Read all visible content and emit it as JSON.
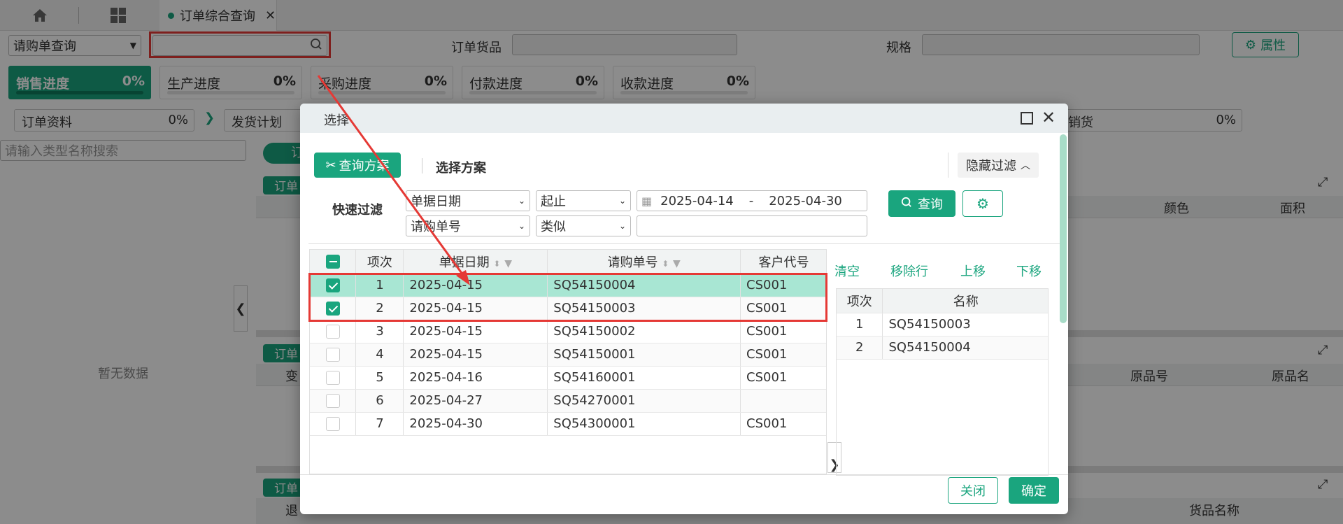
{
  "topbar": {
    "tab_label": "订单综合查询",
    "tab_close": "✕"
  },
  "filter_row": {
    "scheme_select": "请购单查询",
    "order_goods_label": "订单货品",
    "spec_label": "规格",
    "attr_button": "属性"
  },
  "progress": [
    {
      "label": "销售进度",
      "value": "0%"
    },
    {
      "label": "生产进度",
      "value": "0%"
    },
    {
      "label": "采购进度",
      "value": "0%"
    },
    {
      "label": "付款进度",
      "value": "0%"
    },
    {
      "label": "收款进度",
      "value": "0%"
    }
  ],
  "steps": [
    {
      "label": "订单资料",
      "value": "0%"
    },
    {
      "label": "发货计划",
      "value": ""
    },
    {
      "label": "销货",
      "value": "0%"
    }
  ],
  "left_panel": {
    "search_placeholder": "请输入类型名称搜索",
    "empty_text": "暂无数据"
  },
  "bg_labels": {
    "order_a": "订单",
    "order_b": "订单",
    "order_c": "订单",
    "col_color": "颜色",
    "col_area": "面积",
    "col_change": "变",
    "col_orig_no": "原品号",
    "col_orig_name": "原品名",
    "col_back": "退",
    "col_goods_name": "货品名称",
    "btn_partial": "订"
  },
  "dialog": {
    "title": "选择",
    "query_scheme_btn": "查询方案",
    "select_scheme_label": "选择方案",
    "hide_filter_btn": "隐藏过滤",
    "quick_filter_label": "快速过滤",
    "filter1_field": "单据日期",
    "filter1_op": "起止",
    "date_from": "2025-04-14",
    "date_sep": "-",
    "date_to": "2025-04-30",
    "filter2_field": "请购单号",
    "filter2_op": "类似",
    "filter2_value": "",
    "query_btn": "查询",
    "left_grid": {
      "headers": [
        "项次",
        "单据日期",
        "请购单号",
        "客户代号"
      ],
      "rows": [
        {
          "idx": "1",
          "date": "2025-04-15",
          "no": "SQ54150004",
          "cust": "CS001",
          "checked": true
        },
        {
          "idx": "2",
          "date": "2025-04-15",
          "no": "SQ54150003",
          "cust": "CS001",
          "checked": true
        },
        {
          "idx": "3",
          "date": "2025-04-15",
          "no": "SQ54150002",
          "cust": "CS001",
          "checked": false
        },
        {
          "idx": "4",
          "date": "2025-04-15",
          "no": "SQ54150001",
          "cust": "CS001",
          "checked": false
        },
        {
          "idx": "5",
          "date": "2025-04-16",
          "no": "SQ54160001",
          "cust": "CS001",
          "checked": false
        },
        {
          "idx": "6",
          "date": "2025-04-27",
          "no": "SQ54270001",
          "cust": "",
          "checked": false
        },
        {
          "idx": "7",
          "date": "2025-04-30",
          "no": "SQ54300001",
          "cust": "CS001",
          "checked": false
        }
      ]
    },
    "right_actions": [
      "清空",
      "移除行",
      "上移",
      "下移"
    ],
    "right_grid": {
      "headers": [
        "项次",
        "名称"
      ],
      "rows": [
        {
          "idx": "1",
          "name": "SQ54150003"
        },
        {
          "idx": "2",
          "name": "SQ54150004"
        }
      ]
    },
    "close_btn": "关闭",
    "confirm_btn": "确定"
  },
  "colors": {
    "accent": "#1aa57e",
    "highlight": "#e53935",
    "selected_row": "#a8e6d3"
  }
}
